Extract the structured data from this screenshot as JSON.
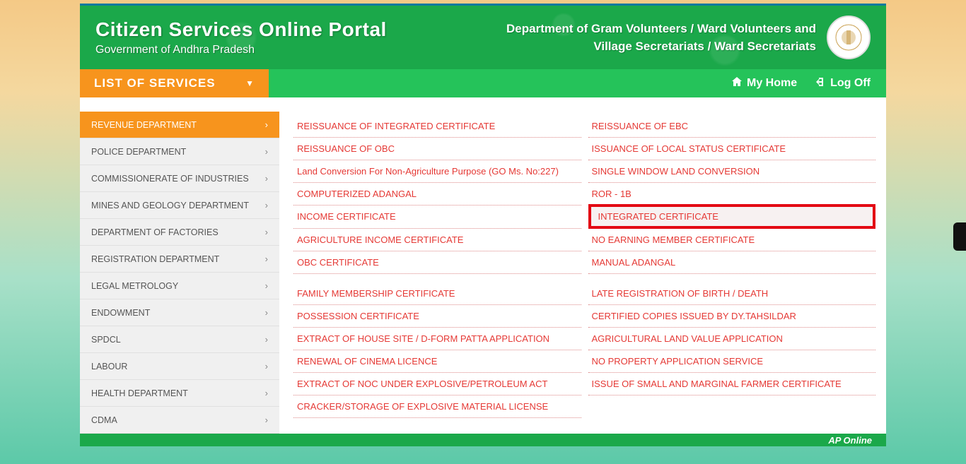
{
  "header": {
    "title": "Citizen Services Online Portal",
    "subtitle": "Government of Andhra Pradesh",
    "dept_line1": "Department of Gram Volunteers / Ward Volunteers and",
    "dept_line2": "Village Secretariats / Ward Secretariats"
  },
  "nav": {
    "list_label": "LIST OF SERVICES",
    "home": "My Home",
    "logoff": "Log Off"
  },
  "sidebar": [
    {
      "label": "REVENUE DEPARTMENT",
      "active": true
    },
    {
      "label": "POLICE DEPARTMENT",
      "active": false
    },
    {
      "label": "COMMISSIONERATE OF INDUSTRIES",
      "active": false
    },
    {
      "label": "MINES AND GEOLOGY DEPARTMENT",
      "active": false
    },
    {
      "label": "DEPARTMENT OF FACTORIES",
      "active": false
    },
    {
      "label": "REGISTRATION DEPARTMENT",
      "active": false
    },
    {
      "label": "LEGAL METROLOGY",
      "active": false
    },
    {
      "label": "ENDOWMENT",
      "active": false
    },
    {
      "label": "SPDCL",
      "active": false
    },
    {
      "label": "LABOUR",
      "active": false
    },
    {
      "label": "HEALTH DEPARTMENT",
      "active": false
    },
    {
      "label": "CDMA",
      "active": false
    }
  ],
  "services": {
    "col1": [
      "REISSUANCE OF INTEGRATED CERTIFICATE",
      "REISSUANCE OF OBC",
      "Land Conversion For Non-Agriculture Purpose (GO Ms. No:227)",
      "COMPUTERIZED ADANGAL",
      "INCOME CERTIFICATE",
      "AGRICULTURE INCOME CERTIFICATE",
      "OBC CERTIFICATE"
    ],
    "col2": [
      "REISSUANCE OF EBC",
      "ISSUANCE OF LOCAL STATUS CERTIFICATE",
      "SINGLE WINDOW LAND CONVERSION",
      "ROR - 1B",
      "INTEGRATED CERTIFICATE",
      "NO EARNING MEMBER CERTIFICATE",
      "MANUAL ADANGAL"
    ],
    "col1b": [
      "FAMILY MEMBERSHIP CERTIFICATE",
      "POSSESSION CERTIFICATE",
      "EXTRACT OF HOUSE SITE / D-FORM PATTA APPLICATION",
      "RENEWAL OF CINEMA LICENCE",
      "EXTRACT OF NOC UNDER EXPLOSIVE/PETROLEUM ACT",
      "CRACKER/STORAGE OF EXPLOSIVE MATERIAL LICENSE"
    ],
    "col2b": [
      "LATE REGISTRATION OF BIRTH / DEATH",
      "CERTIFIED COPIES ISSUED BY DY.TAHSILDAR",
      "AGRICULTURAL LAND VALUE APPLICATION",
      "NO PROPERTY APPLICATION SERVICE",
      "ISSUE OF SMALL AND MARGINAL FARMER CERTIFICATE"
    ],
    "highlighted_index_col2": 4
  },
  "footer": {
    "powered": "AP Online"
  }
}
